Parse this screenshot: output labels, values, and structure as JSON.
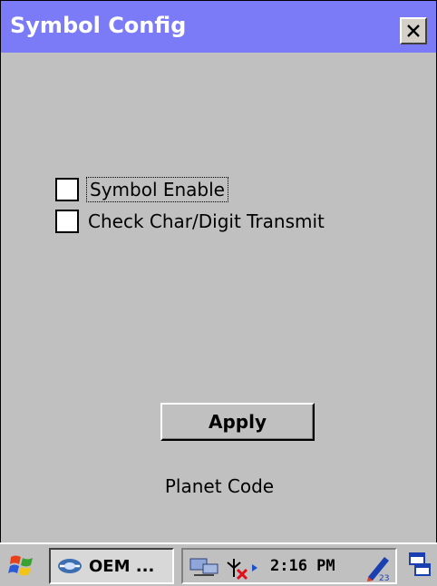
{
  "window": {
    "title": "Symbol Config"
  },
  "options": [
    {
      "label": "Symbol Enable",
      "checked": false
    },
    {
      "label": "Check Char/Digit Transmit",
      "checked": false
    }
  ],
  "apply_label": "Apply",
  "status_text": "Planet Code",
  "taskbar": {
    "task_label": "OEM ...",
    "clock": "2:16 PM",
    "icons": [
      "windows-start-icon",
      "oem-app-icon",
      "network-icon",
      "antenna-disconnected-icon",
      "input-panel-icon",
      "desktop-switch-icon"
    ]
  },
  "colors": {
    "titlebar": "#7b7bf7",
    "window_bg": "#c0c0c0",
    "title_text": "#ffffff"
  }
}
